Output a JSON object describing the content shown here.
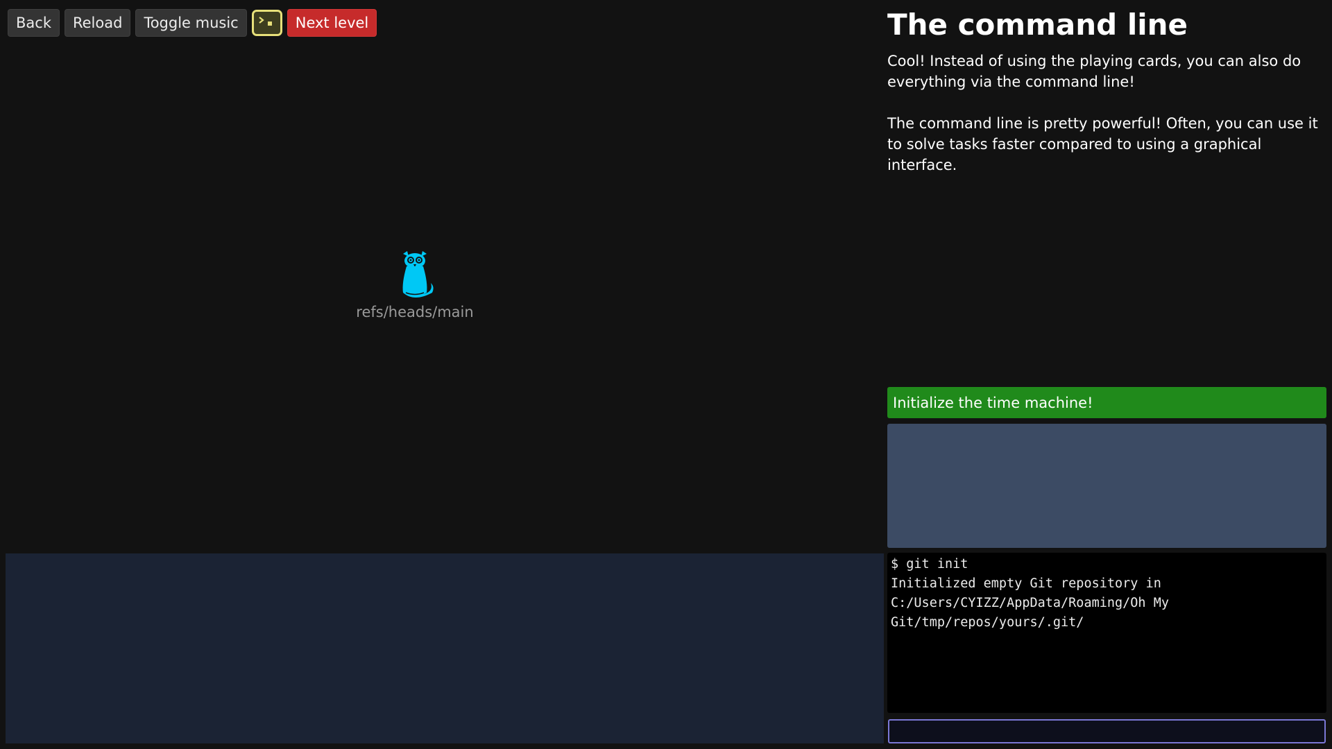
{
  "toolbar": {
    "back_label": "Back",
    "reload_label": "Reload",
    "toggle_music_label": "Toggle music",
    "terminal_toggle_icon": "terminal-icon",
    "next_level_label": "Next level",
    "terminal_toggle_color": "#e7e07a",
    "next_level_color": "#c62b2b"
  },
  "graph": {
    "ref_icon": "owl-icon",
    "ref_name": "refs/heads/main",
    "ref_icon_color": "#00c8f5"
  },
  "level": {
    "title": "The command line",
    "description": [
      "Cool! Instead of using the playing cards, you can also do everything via the command line!",
      "The command line is pretty powerful! Often, you can use it to solve tasks faster compared to using a graphical interface."
    ]
  },
  "goals": [
    {
      "label": "Initialize the time machine!",
      "completed": true,
      "color": "#208a1b"
    }
  ],
  "terminal": {
    "output": [
      "$ git init",
      "Initialized empty Git repository in",
      "C:/Users/CYIZZ/AppData/Roaming/Oh My",
      "Git/tmp/repos/yours/.git/"
    ],
    "input_value": ""
  }
}
